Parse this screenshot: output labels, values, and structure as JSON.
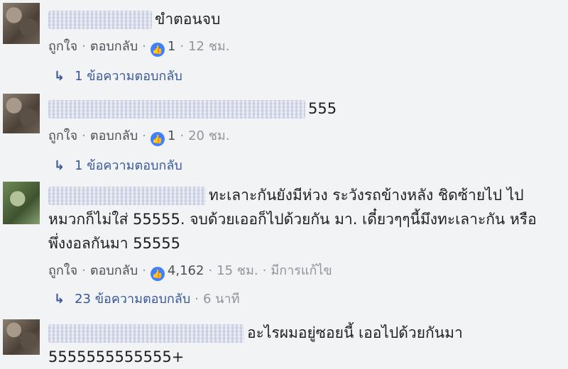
{
  "comments": [
    {
      "text": "ขำตอนจบ",
      "like_label": "ถูกใจ",
      "reply_label": "ตอบกลับ",
      "likes": "1",
      "time": "12 ชม.",
      "replies": "1 ข้อความตอบกลับ"
    },
    {
      "text": "555",
      "like_label": "ถูกใจ",
      "reply_label": "ตอบกลับ",
      "likes": "1",
      "time": "20 ชม.",
      "replies": "1 ข้อความตอบกลับ"
    },
    {
      "text": "ทะเลาะกันยังมีห่วง ระวังรถข้างหลัง ชิดซ้ายไป ไป หมวกก็ไม่ใส่ 55555. จบด้วยเออก็ไปด้วยกัน มา. เดี๋ยวๆๆนี้มึงทะเลาะกัน หรือพึ่งงอลกันมา 55555",
      "like_label": "ถูกใจ",
      "reply_label": "ตอบกลับ",
      "likes": "4,162",
      "time": "15 ชม.",
      "edited": "มีการแก้ไข",
      "replies": "23 ข้อความตอบกลับ",
      "replies_time": "6 นาที"
    },
    {
      "text": "อะไรผมอยู่ซอยนี้ เออไปด้วยกันมา 5555555555555+"
    }
  ],
  "icons": {
    "like": "thumbs-up-icon",
    "reply_arrow": "reply-arrow-icon"
  },
  "colors": {
    "like_blue": "#4080ff",
    "link": "#385898",
    "meta": "#90949c"
  }
}
